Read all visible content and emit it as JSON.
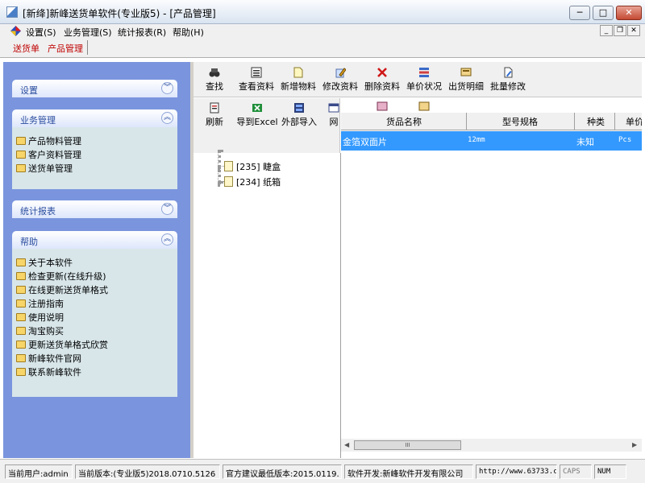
{
  "window": {
    "title": "[新绛]新峰送货单软件(专业版5) - [产品管理]",
    "controls": {
      "minimize": "─",
      "maximize": "□",
      "close": "✕"
    }
  },
  "menu": {
    "items": [
      "设置(S)",
      "业务管理(S)",
      "统计报表(R)",
      "帮助(H)"
    ],
    "mdi": {
      "minimize": "_",
      "restore": "❐",
      "close": "✕"
    }
  },
  "tabs": [
    "送货单",
    "产品管理"
  ],
  "sidebar": {
    "groups": [
      {
        "title": "设置",
        "state": "collapsed",
        "items": []
      },
      {
        "title": "业务管理",
        "state": "expanded",
        "items": [
          "产品物料管理",
          "客户资料管理",
          "送货单管理"
        ]
      },
      {
        "title": "统计报表",
        "state": "collapsed",
        "items": []
      },
      {
        "title": "帮助",
        "state": "expanded",
        "items": [
          "关于本软件",
          "检查更新(在线升级)",
          "在线更新送货单格式",
          "注册指南",
          "使用说明",
          "淘宝购买",
          "更新送货单格式欣赏",
          "新峰软件官网",
          "联系新峰软件"
        ]
      }
    ]
  },
  "toolbar": {
    "buttons": [
      "查找",
      "查看资料",
      "新增物料",
      "修改资料",
      "删除资料",
      "单价状况",
      "出货明细",
      "批量修改"
    ],
    "buttons2": [
      "刷新",
      "导到Excel",
      "外部导入",
      "网"
    ]
  },
  "tree": {
    "items": [
      "[235] 睫盒",
      "[234] 纸箱"
    ]
  },
  "grid": {
    "columns": [
      "货品名称",
      "型号规格",
      "种类",
      "单价"
    ],
    "rows": [
      {
        "name": "金箔双面片",
        "spec": "12mm",
        "kind": "未知",
        "unit": "Pcs"
      }
    ]
  },
  "scrollbar": {
    "grip": "III"
  },
  "status": {
    "user": "当前用户:admin",
    "version": "当前版本:(专业版5)2018.0710.5126",
    "min_version": "官方建议最低版本:2015.0119.",
    "developer": "软件开发:新峰软件开发有限公司",
    "url": "http://www.63733.c",
    "caps": "CAPS",
    "num": "NUM"
  },
  "colors": {
    "sidebar_bg": "#7a95de",
    "group_title": "#2a4d9e",
    "selection": "#3399ff",
    "tab_text": "#c00000"
  }
}
